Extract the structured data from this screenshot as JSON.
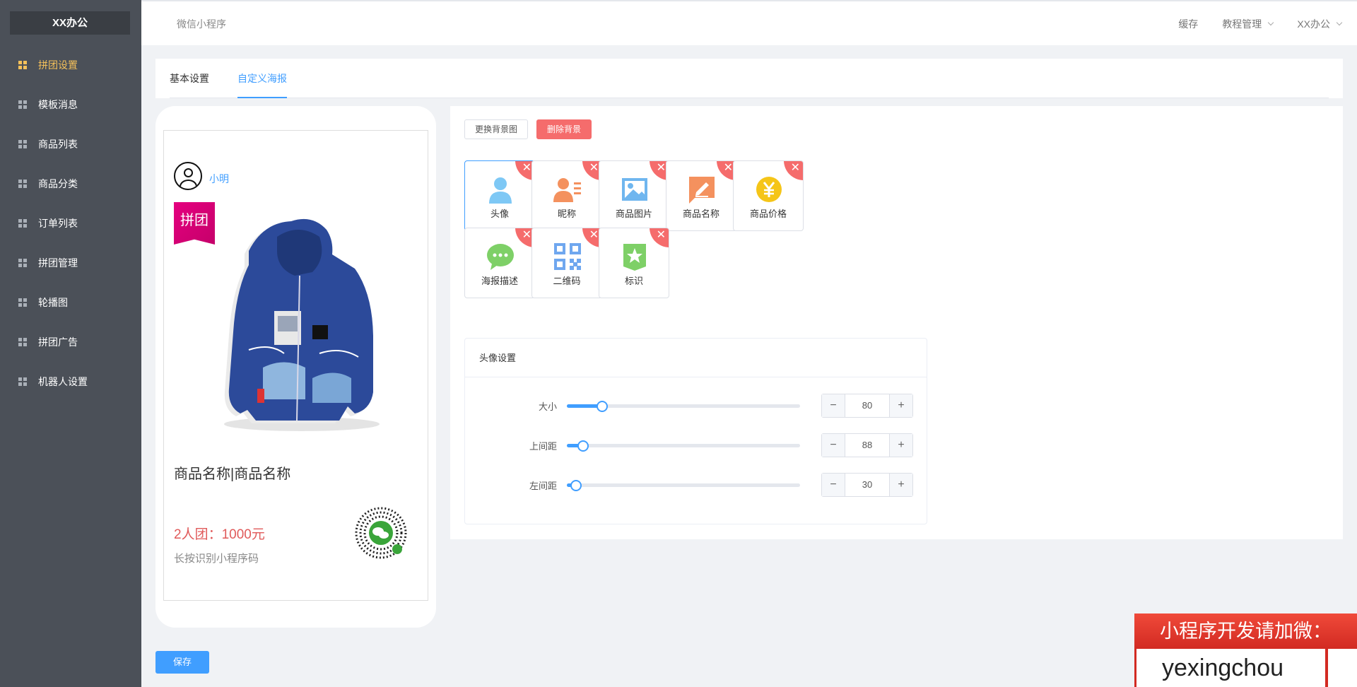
{
  "app": {
    "logo": "XX办公"
  },
  "sidebar": {
    "items": [
      {
        "label": "拼团设置",
        "active": true
      },
      {
        "label": "模板消息"
      },
      {
        "label": "商品列表"
      },
      {
        "label": "商品分类"
      },
      {
        "label": "订单列表"
      },
      {
        "label": "拼团管理"
      },
      {
        "label": "轮播图"
      },
      {
        "label": "拼团广告"
      },
      {
        "label": "机器人设置"
      }
    ]
  },
  "header": {
    "breadcrumb": "微信小程序",
    "cache": "缓存",
    "tutorial": "教程管理",
    "user": "XX办公"
  },
  "tabs": [
    {
      "label": "基本设置"
    },
    {
      "label": "自定义海报",
      "active": true
    }
  ],
  "poster": {
    "nickname": "小明",
    "badge": "拼团",
    "product_title": "商品名称|商品名称",
    "price": "2人团：1000元",
    "hint": "长按识别小程序码"
  },
  "toolbar": {
    "change_bg": "更换背景图",
    "delete_bg": "删除背景"
  },
  "elements": [
    {
      "label": "头像",
      "icon": "avatar-icon",
      "color": "#7ec8f5",
      "selected": true
    },
    {
      "label": "昵称",
      "icon": "nickname-icon",
      "color": "#f4915e"
    },
    {
      "label": "商品图片",
      "icon": "image-icon",
      "color": "#6fb6ef"
    },
    {
      "label": "商品名称",
      "icon": "edit-icon",
      "color": "#f4915e"
    },
    {
      "label": "商品价格",
      "icon": "yen-icon",
      "color": "#f5c518"
    },
    {
      "label": "海报描述",
      "icon": "chat-icon",
      "color": "#7ed067"
    },
    {
      "label": "二维码",
      "icon": "qrcode-icon",
      "color": "#6fa7ef"
    },
    {
      "label": "标识",
      "icon": "badge-icon",
      "color": "#7ed067"
    }
  ],
  "delete_glyph": "✕",
  "avatar_settings": {
    "title": "头像设置",
    "rows": [
      {
        "label": "大小",
        "value": "80",
        "level": 0.15
      },
      {
        "label": "上间距",
        "value": "88",
        "level": 0.07
      },
      {
        "label": "左间距",
        "value": "30",
        "level": 0.04
      }
    ],
    "minus": "−",
    "plus": "+"
  },
  "save": "保存",
  "promo": {
    "line1": "小程序开发请加微：",
    "line2": "yexingchou"
  },
  "colors": {
    "accent": "#409eff",
    "danger": "#f56c6c",
    "active_menu": "#f5c15a",
    "sidebar": "#4b5058"
  }
}
